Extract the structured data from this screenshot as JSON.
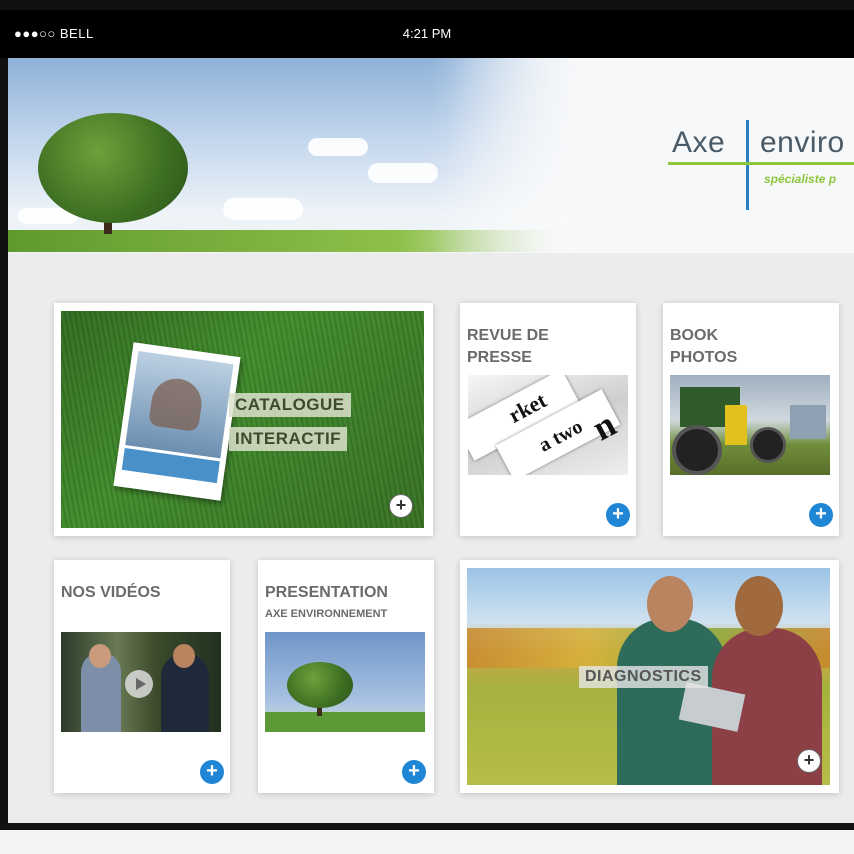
{
  "status_bar": {
    "carrier": "●●●○○ BELL",
    "time": "4:21 PM"
  },
  "brand": {
    "word1": "Axe",
    "word2": "enviro",
    "tagline": "spécialiste p"
  },
  "tiles": {
    "catalogue": {
      "line1": "CATALOGUE",
      "line2": "INTERACTIF"
    },
    "revue": {
      "title_line1": "REVUE DE",
      "title_line2": "PRESSE"
    },
    "book": {
      "title_line1": "BOOK",
      "title_line2": "PHOTOS"
    },
    "videos": {
      "title": "NOS VIDÉOS"
    },
    "presentation": {
      "title": "PRESENTATION",
      "subtitle": "AXE ENVIRONNEMENT"
    },
    "diagnostic": {
      "label": "DIAGNOSTICS"
    }
  },
  "plus_symbol": "+",
  "colors": {
    "accent_blue": "#1f86d6",
    "brand_green": "#8dc63f",
    "brand_blue": "#2b7fc4"
  }
}
